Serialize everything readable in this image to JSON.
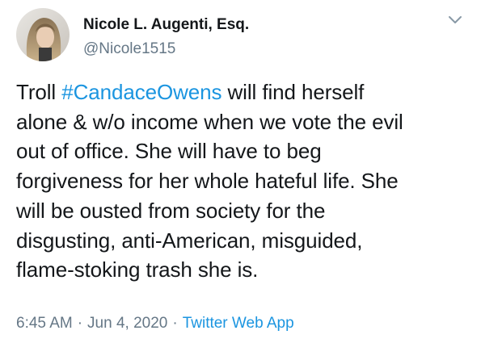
{
  "author": {
    "display_name": "Nicole L. Augenti, Esq.",
    "handle": "@Nicole1515",
    "avatar_icon": "profile-photo-avatar"
  },
  "menu": {
    "icon": "chevron-down-icon"
  },
  "tweet": {
    "line1_prefix": "Troll ",
    "hashtag": "#CandaceOwens",
    "line1_suffix": " will find herself",
    "line2": "alone & w/o income when we vote the evil",
    "line3": "out of office. She will have to beg",
    "line4": "forgiveness for her whole hateful life. She",
    "line5": "will be ousted from society for the",
    "line6": "disgusting, anti-American, misguided,",
    "line7": "flame-stoking trash she is."
  },
  "meta": {
    "time": "6:45 AM",
    "separator": "·",
    "date": "Jun 4, 2020",
    "source": "Twitter Web App"
  },
  "colors": {
    "text": "#14171a",
    "secondary": "#657786",
    "link": "#1b95e0",
    "background": "#ffffff"
  }
}
